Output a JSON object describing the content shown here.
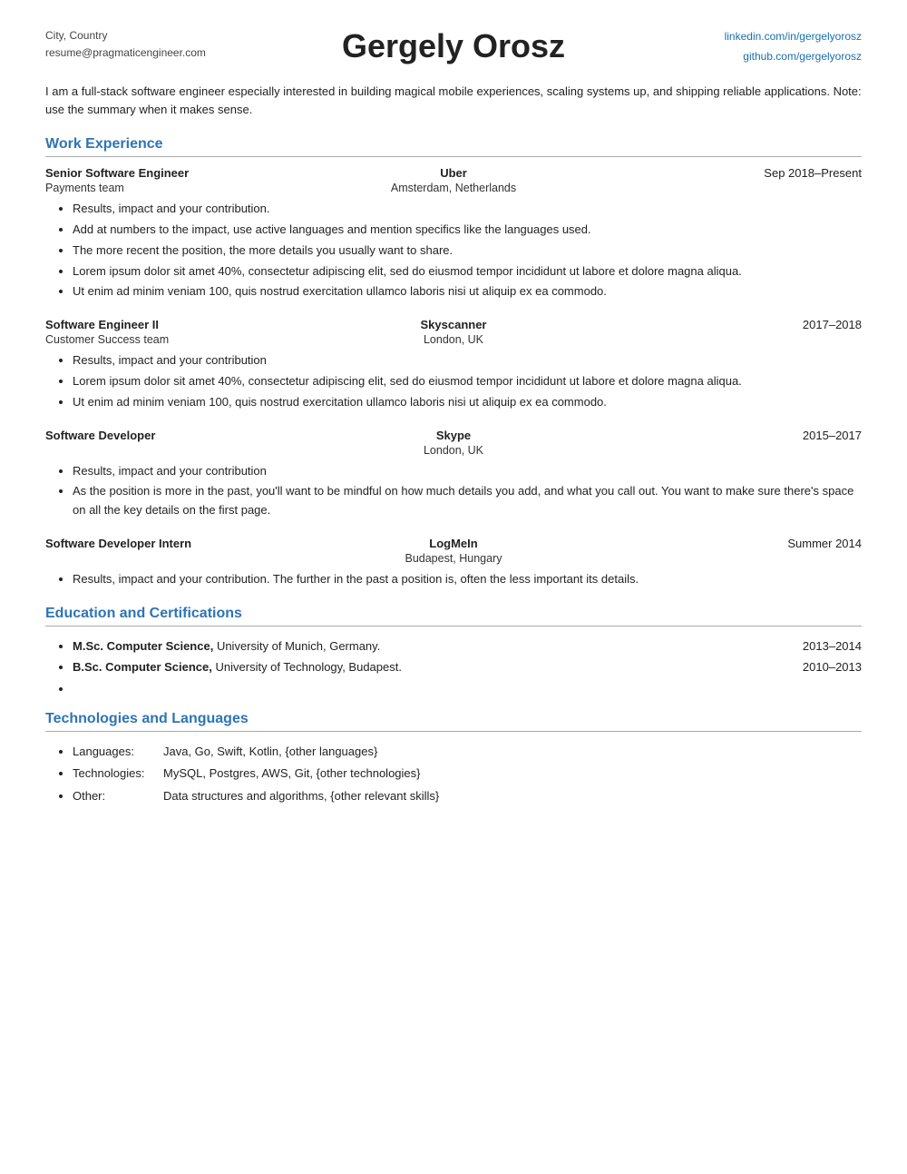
{
  "header": {
    "left_line1": "City, Country",
    "left_line2": "resume@pragmaticengineer.com",
    "name": "Gergely Orosz",
    "right_line1": "linkedin.com/in/gergelyorosz",
    "right_line2": "github.com/gergelyorosz"
  },
  "summary": "I am a full-stack software engineer especially interested in building magical mobile experiences, scaling systems up, and shipping reliable applications. Note: use the summary when it makes sense.",
  "sections": {
    "work_experience": {
      "title": "Work Experience",
      "jobs": [
        {
          "title": "Senior Software Engineer",
          "company": "Uber",
          "date": "Sep 2018–Present",
          "team": "Payments team",
          "location": "Amsterdam, Netherlands",
          "bullets": [
            "Results, impact and your contribution.",
            "Add at numbers to the impact, use active languages and mention specifics like the languages used.",
            "The more recent the position, the more details you usually want to share.",
            "Lorem ipsum dolor sit amet 40%, consectetur adipiscing elit, sed do eiusmod tempor incididunt ut labore et dolore magna aliqua.",
            "Ut enim ad minim veniam 100, quis nostrud exercitation ullamco laboris nisi ut aliquip ex ea commodo."
          ]
        },
        {
          "title": "Software Engineer II",
          "company": "Skyscanner",
          "date": "2017–2018",
          "team": "Customer Success team",
          "location": "London, UK",
          "bullets": [
            "Results, impact and your contribution",
            "Lorem ipsum dolor sit amet 40%, consectetur adipiscing elit, sed do eiusmod tempor incididunt ut labore et dolore magna aliqua.",
            "Ut enim ad minim veniam 100, quis nostrud exercitation ullamco laboris nisi ut aliquip ex ea commodo."
          ]
        },
        {
          "title": "Software Developer",
          "company": "Skype",
          "date": "2015–2017",
          "team": "",
          "location": "London, UK",
          "bullets": [
            "Results, impact and your contribution",
            "As the position is more in the past, you'll want to be mindful on how much details you add, and what you call out. You want to make sure there's space on all the key details on the first page."
          ]
        },
        {
          "title": "Software Developer Intern",
          "company": "LogMeIn",
          "date": "Summer 2014",
          "team": "",
          "location": "Budapest, Hungary",
          "bullets": [
            "Results, impact and your contribution. The further in the past a position is, often the less important its details."
          ]
        }
      ]
    },
    "education": {
      "title": "Education and Certifications",
      "items": [
        {
          "text_bold": "M.Sc. Computer Science,",
          "text_rest": " University of Munich, Germany.",
          "year": "2013–2014"
        },
        {
          "text_bold": "B.Sc. Computer Science,",
          "text_rest": " University of Technology, Budapest.",
          "year": "2010–2013"
        },
        {
          "text_bold": "",
          "text_rest": "",
          "year": ""
        }
      ]
    },
    "technologies": {
      "title": "Technologies and Languages",
      "items": [
        {
          "label": "Languages:",
          "value": "Java, Go, Swift, Kotlin, {other languages}"
        },
        {
          "label": "Technologies:",
          "value": "MySQL, Postgres, AWS, Git, {other technologies}"
        },
        {
          "label": "Other:",
          "value": "Data structures and algorithms, {other relevant skills}"
        }
      ]
    }
  }
}
